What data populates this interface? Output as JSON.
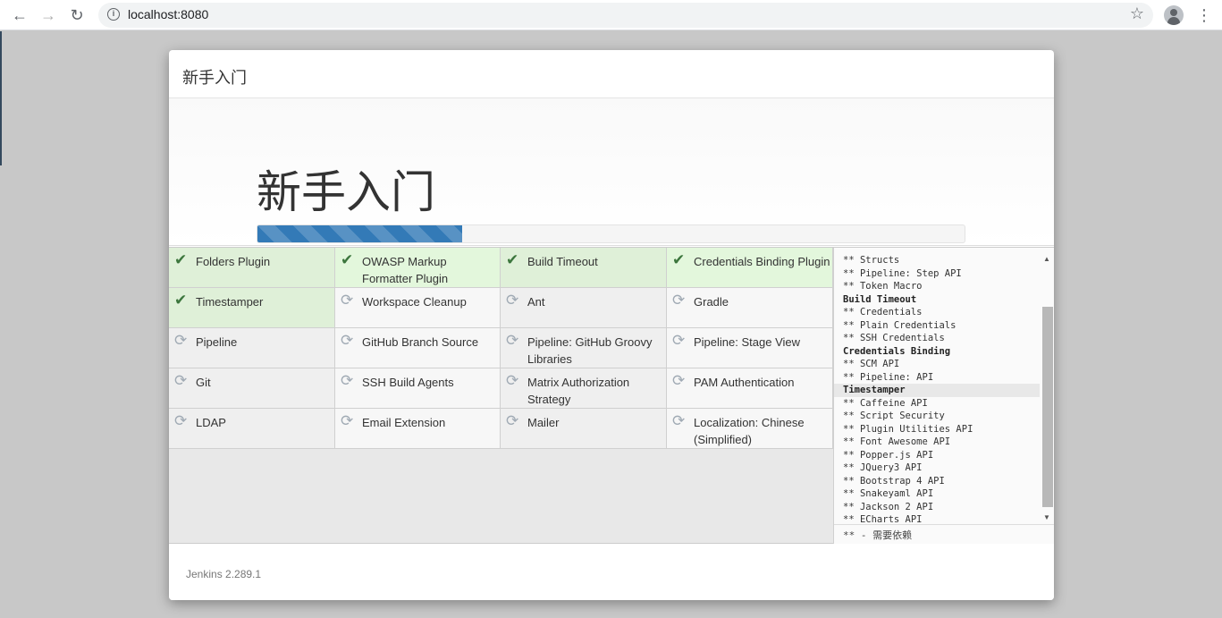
{
  "browser": {
    "url": "localhost:8080",
    "back_icon": "←",
    "forward_icon": "→",
    "reload_icon": "↻",
    "info_icon": "i",
    "star_icon": "☆",
    "menu_icon": "⋮"
  },
  "dialog": {
    "header_title": "新手入门",
    "hero_title": "新手入门",
    "progress_percent": 29,
    "footer_version": "Jenkins 2.289.1"
  },
  "plugins": [
    {
      "name": "Folders Plugin",
      "status": "done"
    },
    {
      "name": "OWASP Markup Formatter Plugin",
      "status": "done"
    },
    {
      "name": "Build Timeout",
      "status": "done"
    },
    {
      "name": "Credentials Binding Plugin",
      "status": "done"
    },
    {
      "name": "Timestamper",
      "status": "done"
    },
    {
      "name": "Workspace Cleanup",
      "status": "pending"
    },
    {
      "name": "Ant",
      "status": "pending"
    },
    {
      "name": "Gradle",
      "status": "pending"
    },
    {
      "name": "Pipeline",
      "status": "pending"
    },
    {
      "name": "GitHub Branch Source",
      "status": "pending"
    },
    {
      "name": "Pipeline: GitHub Groovy Libraries",
      "status": "pending"
    },
    {
      "name": "Pipeline: Stage View",
      "status": "pending"
    },
    {
      "name": "Git",
      "status": "pending"
    },
    {
      "name": "SSH Build Agents",
      "status": "pending"
    },
    {
      "name": "Matrix Authorization Strategy",
      "status": "pending"
    },
    {
      "name": "PAM Authentication",
      "status": "pending"
    },
    {
      "name": "LDAP",
      "status": "pending"
    },
    {
      "name": "Email Extension",
      "status": "pending"
    },
    {
      "name": "Mailer",
      "status": "pending"
    },
    {
      "name": "Localization: Chinese (Simplified)",
      "status": "pending"
    }
  ],
  "log": {
    "lines": [
      {
        "text": "** Structs",
        "type": "dep"
      },
      {
        "text": "** Pipeline: Step API",
        "type": "dep"
      },
      {
        "text": "** Token Macro",
        "type": "dep"
      },
      {
        "text": "Build Timeout",
        "type": "header"
      },
      {
        "text": "** Credentials",
        "type": "dep"
      },
      {
        "text": "** Plain Credentials",
        "type": "dep"
      },
      {
        "text": "** SSH Credentials",
        "type": "dep"
      },
      {
        "text": "Credentials Binding",
        "type": "header"
      },
      {
        "text": "** SCM API",
        "type": "dep"
      },
      {
        "text": "** Pipeline: API",
        "type": "dep"
      },
      {
        "text": "Timestamper",
        "type": "header-selected"
      },
      {
        "text": "** Caffeine API",
        "type": "dep"
      },
      {
        "text": "** Script Security",
        "type": "dep"
      },
      {
        "text": "** Plugin Utilities API",
        "type": "dep"
      },
      {
        "text": "** Font Awesome API",
        "type": "dep"
      },
      {
        "text": "** Popper.js API",
        "type": "dep"
      },
      {
        "text": "** JQuery3 API",
        "type": "dep"
      },
      {
        "text": "** Bootstrap 4 API",
        "type": "dep"
      },
      {
        "text": "** Snakeyaml API",
        "type": "dep"
      },
      {
        "text": "** Jackson 2 API",
        "type": "dep"
      },
      {
        "text": "** ECharts API",
        "type": "dep"
      }
    ],
    "footer": "** - 需要依赖"
  },
  "icons": {
    "done": "✔",
    "pending": "⟳"
  },
  "colors": {
    "progress": "#337ab7",
    "done_bg": "#dff0d8",
    "check": "#3c763d"
  }
}
